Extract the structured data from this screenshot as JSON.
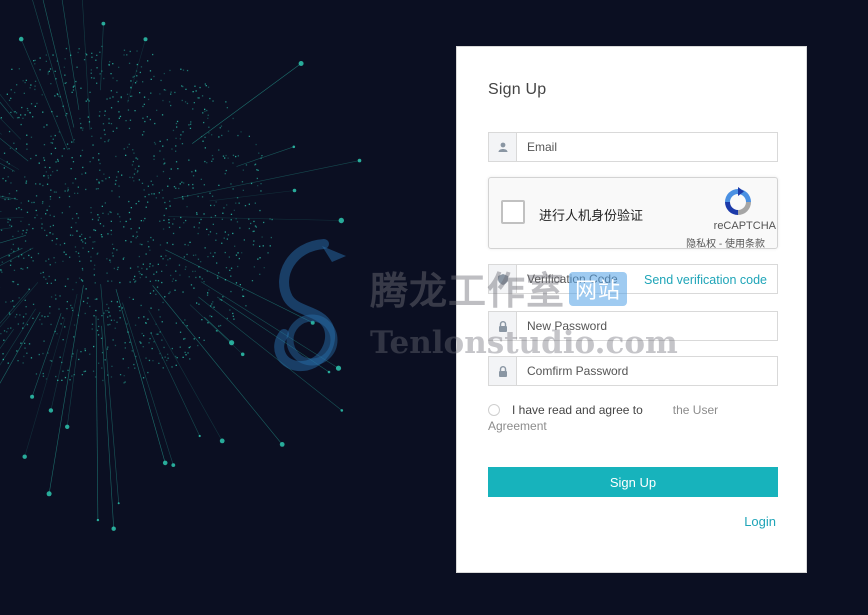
{
  "form": {
    "title": "Sign Up",
    "email_placeholder": "Email",
    "recaptcha": {
      "checkbox_label": "进行人机身份验证",
      "brand": "reCAPTCHA",
      "terms": "隐私权 - 使用条款"
    },
    "verification_placeholder": "Verification Code",
    "send_code_label": "Send verification code",
    "new_password_placeholder": "New Password",
    "confirm_password_placeholder": "Comfirm Password",
    "agree_text": "I have read and agree to",
    "agreement_link_part1": "the User",
    "agreement_link_part2": "Agreement",
    "submit_label": "Sign Up",
    "login_label": "Login"
  },
  "watermark": {
    "cn": "腾龙工作室",
    "cn_badge": "网站",
    "en": "Tenlonstudio.com"
  },
  "colors": {
    "background": "#0b0f22",
    "accent": "#17b3bc",
    "link": "#1fa5b8",
    "globe_dots": "#2fd1b8"
  },
  "icons": {
    "email": "user-icon",
    "verification": "shield-icon",
    "password": "lock-icon"
  }
}
